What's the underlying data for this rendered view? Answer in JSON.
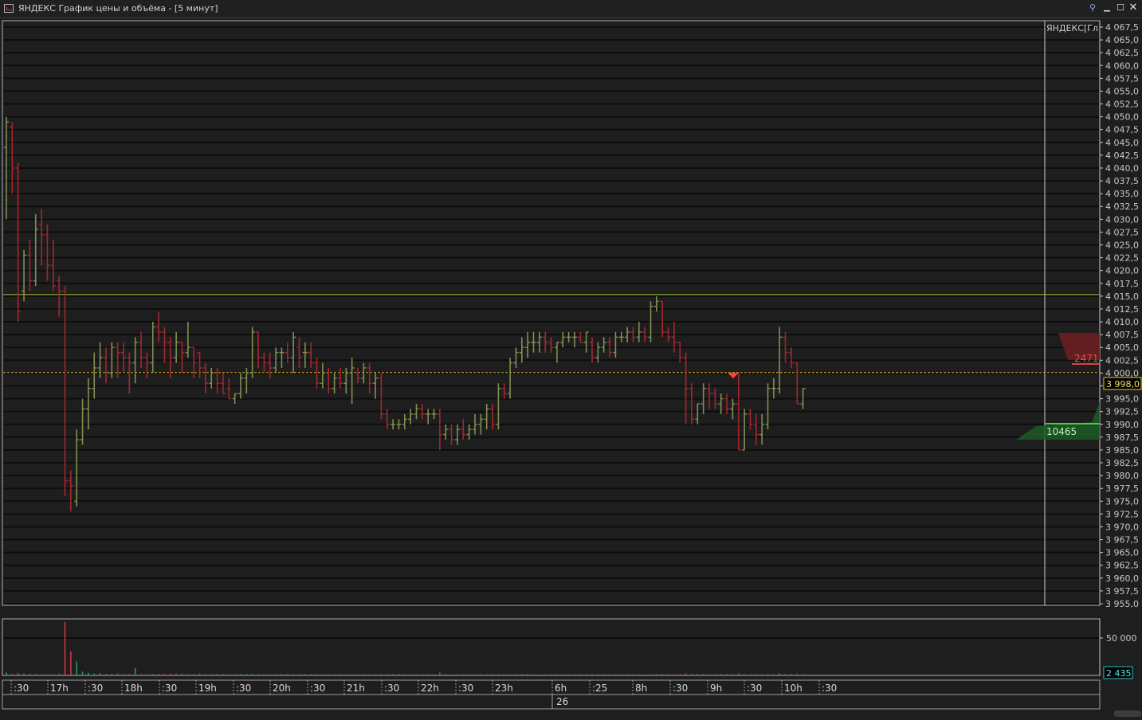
{
  "window": {
    "title": "ЯНДЕКС График цены и объёма - [5 минут]",
    "buttons": {
      "link": "⚲",
      "minimize": "▁",
      "maximize": "☐",
      "close": "✕"
    }
  },
  "price_pane": {
    "instrument_label": "ЯНДЕКС[Гл",
    "y_ticks": [
      "4 067,5",
      "4 065,0",
      "4 062,5",
      "4 060,0",
      "4 057,5",
      "4 055,0",
      "4 052,5",
      "4 050,0",
      "4 047,5",
      "4 045,0",
      "4 042,5",
      "4 040,0",
      "4 037,5",
      "4 035,0",
      "4 032,5",
      "4 030,0",
      "4 027,5",
      "4 025,0",
      "4 022,5",
      "4 020,0",
      "4 017,5",
      "4 015,0",
      "4 012,5",
      "4 010,0",
      "4 007,5",
      "4 005,0",
      "4 002,5",
      "4 000,0",
      "3 997,5",
      "3 995,0",
      "3 992,5",
      "3 990,0",
      "3 987,5",
      "3 985,0",
      "3 982,5",
      "3 980,0",
      "3 977,5",
      "3 975,0",
      "3 972,5",
      "3 970,0",
      "3 967,5",
      "3 965,0",
      "3 962,5",
      "3 960,0",
      "3 957,5",
      "3 955,0"
    ],
    "current_price_label": "3 998,0",
    "sell_volume_label": "2471",
    "buy_volume_label": "10465",
    "horizontal_level": 4015.3,
    "dashed_level": 4000.1,
    "colors": {
      "up": "#7f8f50",
      "down": "#a3262f",
      "level": "#9ec23a",
      "dashed": "#e0b030",
      "grid": "#0d0d0d",
      "bg": "#1e1e1e"
    }
  },
  "volume_pane": {
    "y_label": "50 000",
    "current_volume_label": "2 435",
    "colors": {
      "up": "#1f9a6b",
      "down": "#c43a3a"
    }
  },
  "time_axis": {
    "labels": [
      ":30",
      "17h",
      ":30",
      "18h",
      ":30",
      "19h",
      ":30",
      "20h",
      ":30",
      "21h",
      ":30",
      "22h",
      ":30",
      "23h",
      "6h",
      ":25",
      "8h",
      ":30",
      "9h",
      ":30",
      "10h",
      ":30"
    ],
    "date_label": "26"
  },
  "chart_data": {
    "type": "ohlc",
    "price_ylim": [
      3955.0,
      4067.5
    ],
    "volume_ylim": [
      0,
      75000
    ],
    "bars": [
      [
        4044,
        4050,
        4030,
        4049,
        3000
      ],
      [
        4048,
        4049,
        4035,
        4040,
        1200
      ],
      [
        4040,
        4041,
        4010,
        4012,
        2300
      ],
      [
        4016,
        4024,
        4014,
        4023,
        1500
      ],
      [
        4023,
        4026,
        4016,
        4018,
        1000
      ],
      [
        4018,
        4031,
        4017,
        4028,
        800
      ],
      [
        4029,
        4032,
        4021,
        4027,
        400
      ],
      [
        4027,
        4029,
        4018,
        4021,
        300
      ],
      [
        4021,
        4026,
        4016,
        4017,
        800
      ],
      [
        4018,
        4019,
        4011,
        4016,
        1200
      ],
      [
        4016,
        4017,
        3976,
        3979,
        72000
      ],
      [
        3979,
        3981,
        3973,
        3978,
        32000
      ],
      [
        3975,
        3989,
        3974,
        3987,
        18000
      ],
      [
        3987,
        3995,
        3986,
        3993,
        4000
      ],
      [
        3993,
        3999,
        3989,
        3997,
        2500
      ],
      [
        3997,
        4004,
        3995,
        4001,
        1500
      ],
      [
        4001,
        4006,
        3999,
        4003,
        1800
      ],
      [
        4003,
        4005,
        3998,
        4000,
        1200
      ],
      [
        4000,
        4006,
        3999,
        4005,
        900
      ],
      [
        4005,
        4006,
        3999,
        4004,
        1500
      ],
      [
        4004,
        4006,
        4000,
        4003,
        800
      ],
      [
        4003,
        4004,
        3996,
        4002,
        1000
      ],
      [
        4002,
        4007,
        3998,
        4006,
        9000
      ],
      [
        4006,
        4008,
        4001,
        4003,
        800
      ],
      [
        4003,
        4004,
        3999,
        4002,
        700
      ],
      [
        4002,
        4010,
        4000,
        4009,
        800
      ],
      [
        4009,
        4012,
        4006,
        4008,
        900
      ],
      [
        4008,
        4009,
        4002,
        4006,
        1200
      ],
      [
        4006,
        4007,
        3999,
        4003,
        1500
      ],
      [
        4003,
        4008,
        4002,
        4006,
        800
      ],
      [
        4006,
        4006,
        4000,
        4004,
        1500
      ],
      [
        4004,
        4010,
        4003,
        4005,
        600
      ],
      [
        4005,
        4005,
        3999,
        4002,
        800
      ],
      [
        4004,
        4004,
        3999,
        4001,
        1400
      ],
      [
        4001,
        4002,
        3996,
        3998,
        800
      ],
      [
        3998,
        4001,
        3997,
        4000,
        700
      ],
      [
        4000,
        4001,
        3996,
        3998,
        600
      ],
      [
        3998,
        4000,
        3996,
        3996,
        800
      ],
      [
        3997,
        3999,
        3995,
        3995,
        600
      ],
      [
        3995,
        3996,
        3994,
        3996,
        700
      ],
      [
        3996,
        4000,
        3995,
        3999,
        800
      ],
      [
        3999,
        4001,
        3996,
        4000,
        500
      ],
      [
        4000,
        4009,
        3999,
        4008,
        900
      ],
      [
        4008,
        4008,
        4001,
        4003,
        800
      ],
      [
        4003,
        4004,
        4000,
        4002,
        700
      ],
      [
        4002,
        4004,
        3999,
        4001,
        500
      ],
      [
        4001,
        4005,
        4000,
        4004,
        600
      ],
      [
        4004,
        4005,
        4001,
        4004,
        800
      ],
      [
        4004,
        4006,
        4002,
        4003,
        700
      ],
      [
        4003,
        4008,
        4000,
        4007,
        700
      ],
      [
        4005,
        4007,
        4001,
        4003,
        800
      ],
      [
        4004,
        4006,
        4001,
        4004,
        600
      ],
      [
        4004,
        4006,
        4001,
        4002,
        700
      ],
      [
        4002,
        4003,
        3997,
        3998,
        900
      ],
      [
        3998,
        4002,
        3997,
        4000,
        600
      ],
      [
        4000,
        4001,
        3996,
        3997,
        500
      ],
      [
        3997,
        4000,
        3996,
        3999,
        400
      ],
      [
        3999,
        4001,
        3997,
        3998,
        600
      ],
      [
        3998,
        4001,
        3996,
        4000,
        500
      ],
      [
        4000,
        4003,
        3994,
        4001,
        500
      ],
      [
        4000,
        4001,
        3998,
        3999,
        600
      ],
      [
        3999,
        4002,
        3998,
        4001,
        700
      ],
      [
        4001,
        4002,
        3996,
        3998,
        500
      ],
      [
        3998,
        4000,
        3995,
        3999,
        400
      ],
      [
        3999,
        4000,
        3991,
        3992,
        900
      ],
      [
        3992,
        3993,
        3989,
        3990,
        700
      ],
      [
        3990,
        3991,
        3989,
        3990,
        500
      ],
      [
        3990,
        3991,
        3989,
        3990,
        800
      ],
      [
        3990,
        3992,
        3989,
        3991,
        600
      ],
      [
        3991,
        3993,
        3990,
        3992,
        400
      ],
      [
        3992,
        3994,
        3991,
        3993,
        500
      ],
      [
        3993,
        3994,
        3991,
        3992,
        400
      ],
      [
        3992,
        3993,
        3990,
        3992,
        500
      ],
      [
        3992,
        3993,
        3991,
        3992,
        400
      ],
      [
        3992,
        3993,
        3985,
        3988,
        3000
      ],
      [
        3988,
        3990,
        3987,
        3989,
        600
      ],
      [
        3989,
        3990,
        3986,
        3987,
        400
      ],
      [
        3987,
        3990,
        3986,
        3989,
        500
      ],
      [
        3989,
        3991,
        3987,
        3988,
        600
      ],
      [
        3988,
        3990,
        3987,
        3989,
        400
      ],
      [
        3989,
        3992,
        3988,
        3990,
        500
      ],
      [
        3990,
        3992,
        3988,
        3991,
        600
      ],
      [
        3991,
        3994,
        3989,
        3993,
        400
      ],
      [
        3993,
        3994,
        3989,
        3990,
        600
      ],
      [
        3990,
        3998,
        3989,
        3997,
        700
      ],
      [
        3997,
        3998,
        3995,
        3996,
        600
      ],
      [
        3996,
        4003,
        3995,
        4002,
        500
      ],
      [
        4002,
        4005,
        4001,
        4004,
        600
      ],
      [
        4004,
        4007,
        4002,
        4005,
        800
      ],
      [
        4005,
        4008,
        4003,
        4006,
        700
      ],
      [
        4006,
        4008,
        4004,
        4006,
        500
      ],
      [
        4006,
        4008,
        4004,
        4007,
        400
      ],
      [
        4007,
        4008,
        4004,
        4006,
        600
      ],
      [
        4006,
        4007,
        4004,
        4005,
        500
      ],
      [
        4005,
        4006,
        4002,
        4006,
        600
      ],
      [
        4006,
        4008,
        4005,
        4007,
        500
      ],
      [
        4007,
        4008,
        4006,
        4007,
        400
      ],
      [
        4007,
        4008,
        4005,
        4007,
        600
      ],
      [
        4007,
        4008,
        4006,
        4006,
        500
      ],
      [
        4006,
        4008,
        4004,
        4008,
        700
      ],
      [
        4006,
        4007,
        4002,
        4003,
        800
      ],
      [
        4003,
        4006,
        4002,
        4005,
        600
      ],
      [
        4005,
        4007,
        4004,
        4006,
        500
      ],
      [
        4006,
        4007,
        4003,
        4004,
        600
      ],
      [
        4004,
        4008,
        4003,
        4007,
        500
      ],
      [
        4007,
        4008,
        4006,
        4007,
        400
      ],
      [
        4007,
        4009,
        4006,
        4008,
        500
      ],
      [
        4008,
        4009,
        4006,
        4007,
        600
      ],
      [
        4007,
        4010,
        4006,
        4008,
        500
      ],
      [
        4008,
        4009,
        4006,
        4007,
        400
      ],
      [
        4007,
        4014,
        4006,
        4013,
        600
      ],
      [
        4013,
        4015,
        4012,
        4014,
        600
      ],
      [
        4014,
        4014,
        4007,
        4008,
        900
      ],
      [
        4008,
        4009,
        4006,
        4007,
        700
      ],
      [
        4007,
        4010,
        4004,
        4006,
        500
      ],
      [
        4006,
        4006,
        4002,
        4003,
        900
      ],
      [
        4003,
        4004,
        3990,
        3997,
        1700
      ],
      [
        3997,
        3998,
        3990,
        3991,
        900
      ],
      [
        3991,
        3994,
        3990,
        3994,
        600
      ],
      [
        3994,
        3998,
        3992,
        3997,
        800
      ],
      [
        3997,
        3998,
        3993,
        3996,
        500
      ],
      [
        3996,
        3997,
        3993,
        3994,
        700
      ],
      [
        3994,
        3996,
        3992,
        3995,
        600
      ],
      [
        3995,
        3996,
        3992,
        3993,
        800
      ],
      [
        3993,
        3995,
        3991,
        3994,
        600
      ],
      [
        3994,
        4000,
        3985,
        3985,
        1900
      ],
      [
        3985,
        3993,
        3985,
        3992,
        800
      ],
      [
        3992,
        3993,
        3989,
        3990,
        600
      ],
      [
        3990,
        3992,
        3986,
        3988,
        700
      ],
      [
        3988,
        3992,
        3986,
        3990,
        500
      ],
      [
        3990,
        3998,
        3989,
        3997,
        900
      ],
      [
        3997,
        3999,
        3995,
        3997,
        700
      ],
      [
        3997,
        4009,
        3996,
        4007,
        1800
      ],
      [
        4007,
        4008,
        4002,
        4004,
        900
      ],
      [
        4004,
        4005,
        4001,
        4002,
        700
      ],
      [
        4002,
        4002,
        3994,
        3994,
        1200
      ],
      [
        3994,
        3997,
        3993,
        3997,
        800
      ]
    ]
  }
}
